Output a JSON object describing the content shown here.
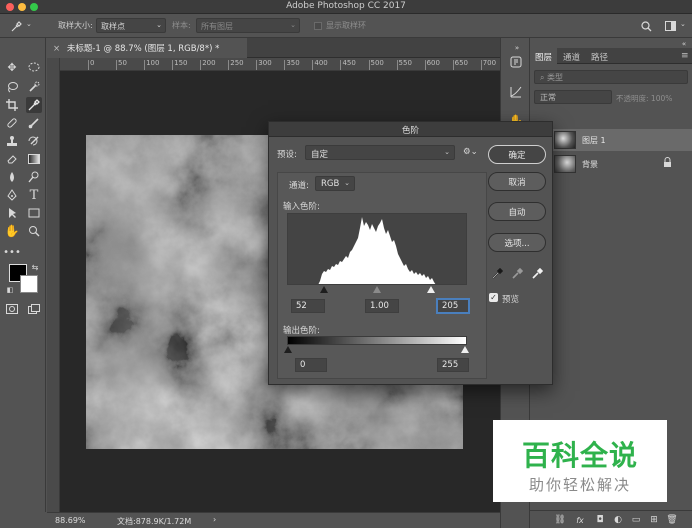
{
  "window": {
    "title": "Adobe Photoshop CC 2017"
  },
  "options_bar": {
    "sample_size_label": "取样大小:",
    "sample_size_value": "取样点",
    "sample_label": "样本:",
    "sample_value": "所有图层",
    "show_ring_label": "显示取样环"
  },
  "document": {
    "tab_title": "未标题-1 @ 88.7% (图层 1, RGB/8*) *",
    "ruler_marks": [
      "0",
      "50",
      "100",
      "150",
      "200",
      "250",
      "300",
      "350",
      "400",
      "450",
      "500",
      "550",
      "600",
      "650",
      "700",
      "750"
    ]
  },
  "status": {
    "zoom": "88.69%",
    "doc_info": "文档:878.9K/1.72M",
    "arrow": "›"
  },
  "layers_panel": {
    "tabs": [
      "图层",
      "通道",
      "路径"
    ],
    "filter_placeholder": "类型",
    "blend_mode": "正常",
    "opacity_label": "不透明度:",
    "opacity_value": "100%",
    "layers": [
      {
        "name": "图层 1",
        "selected": true
      },
      {
        "name": "背景",
        "selected": false,
        "locked": true
      }
    ]
  },
  "levels_dialog": {
    "title": "色阶",
    "preset_label": "预设:",
    "preset_value": "自定",
    "channel_label": "通道:",
    "channel_value": "RGB",
    "input_levels_label": "输入色阶:",
    "input_black": "52",
    "input_gamma": "1.00",
    "input_white": "205",
    "output_levels_label": "输出色阶:",
    "output_black": "0",
    "output_white": "255",
    "buttons": {
      "ok": "确定",
      "cancel": "取消",
      "auto": "自动",
      "options": "选项..."
    },
    "preview_label": "预览",
    "preview_checked": true
  },
  "watermark": {
    "title": "百科全说",
    "subtitle": "助你轻松解决"
  },
  "colors": {
    "accent": "#4a7fbd",
    "watermark_green": "#2fb24c"
  }
}
